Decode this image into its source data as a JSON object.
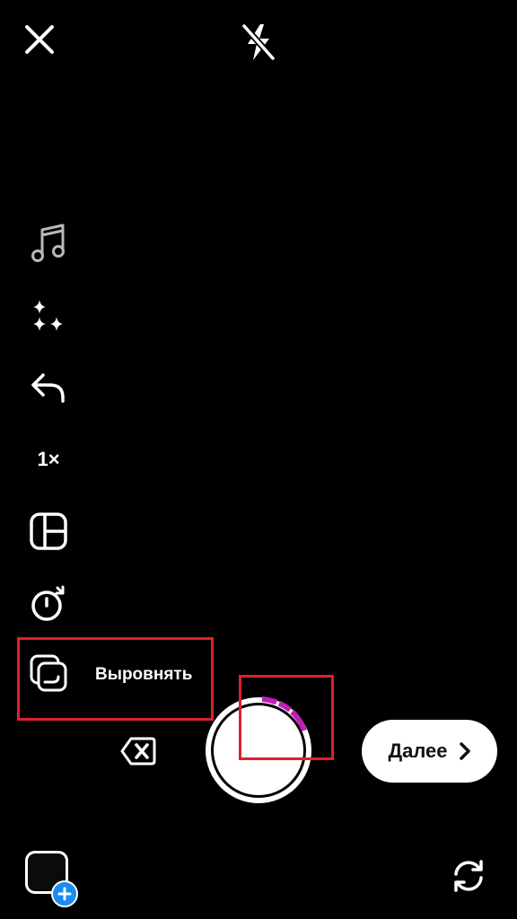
{
  "top_bar": {
    "close_icon": "close-icon",
    "flash_icon": "flash-off-icon"
  },
  "tools": [
    {
      "id": "music",
      "icon": "music-note-icon"
    },
    {
      "id": "effects",
      "icon": "sparkles-icon"
    },
    {
      "id": "undo",
      "icon": "undo-arrow-icon"
    },
    {
      "id": "zoom",
      "label": "1×"
    },
    {
      "id": "layout",
      "icon": "layout-grid-icon"
    },
    {
      "id": "timer",
      "icon": "timer-icon"
    },
    {
      "id": "align",
      "icon": "align-layers-icon",
      "label": "Выровнять"
    }
  ],
  "capture": {
    "delete_icon": "backspace-icon",
    "shutter_icon": "shutter-ring-icon",
    "recording_progress_color": "#c01fb8"
  },
  "next_button": {
    "label": "Далее",
    "icon": "chevron-right-icon"
  },
  "bottom_bar": {
    "gallery_icon": "gallery-add-icon",
    "flip_icon": "flip-camera-icon",
    "accent_color": "#1a8cf0"
  },
  "highlight_color": "#e0202a"
}
